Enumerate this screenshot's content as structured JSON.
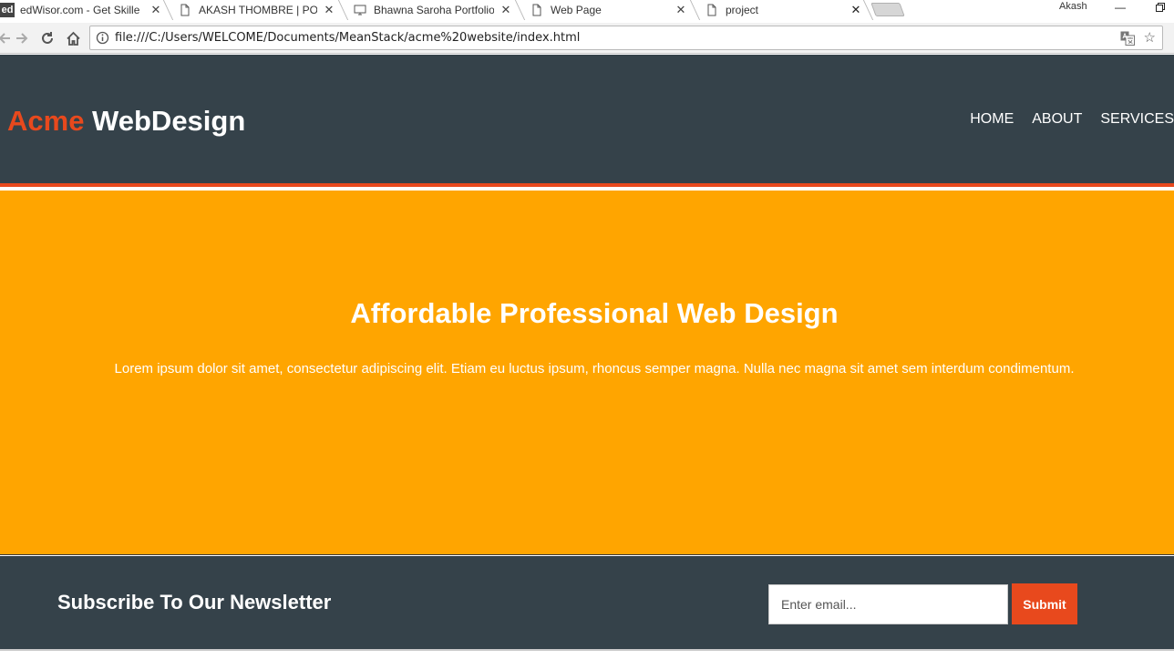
{
  "browser": {
    "tabs": [
      {
        "title": "edWisor.com - Get Skille",
        "favicon": "edwisor-logo-icon",
        "active": false
      },
      {
        "title": "AKASH THOMBRE | PORT",
        "favicon": "page-icon",
        "active": false
      },
      {
        "title": "Bhawna Saroha Portfolio",
        "favicon": "monitor-icon",
        "active": false
      },
      {
        "title": "Web Page",
        "favicon": "page-icon",
        "active": false
      },
      {
        "title": "project",
        "favicon": "page-icon",
        "active": true
      }
    ],
    "edwisor_logo_text": "ed",
    "profile_name": "Akash",
    "url": "file:///C:/Users/WELCOME/Documents/MeanStack/acme%20website/index.html"
  },
  "site": {
    "brand_highlight": "Acme",
    "brand_rest": " WebDesign",
    "nav": [
      "HOME",
      "ABOUT",
      "SERVICES"
    ],
    "showcase": {
      "title": "Affordable Professional Web Design",
      "text": "Lorem ipsum dolor sit amet, consectetur adipiscing elit. Etiam eu luctus ipsum, rhoncus semper magna. Nulla nec magna sit amet sem interdum condimentum."
    },
    "newsletter": {
      "heading": "Subscribe To Our Newsletter",
      "placeholder": "Enter email...",
      "submit_label": "Submit"
    }
  },
  "colors": {
    "header_bg": "#35424a",
    "accent": "#e8491d",
    "showcase_bg": "#ffa500"
  }
}
